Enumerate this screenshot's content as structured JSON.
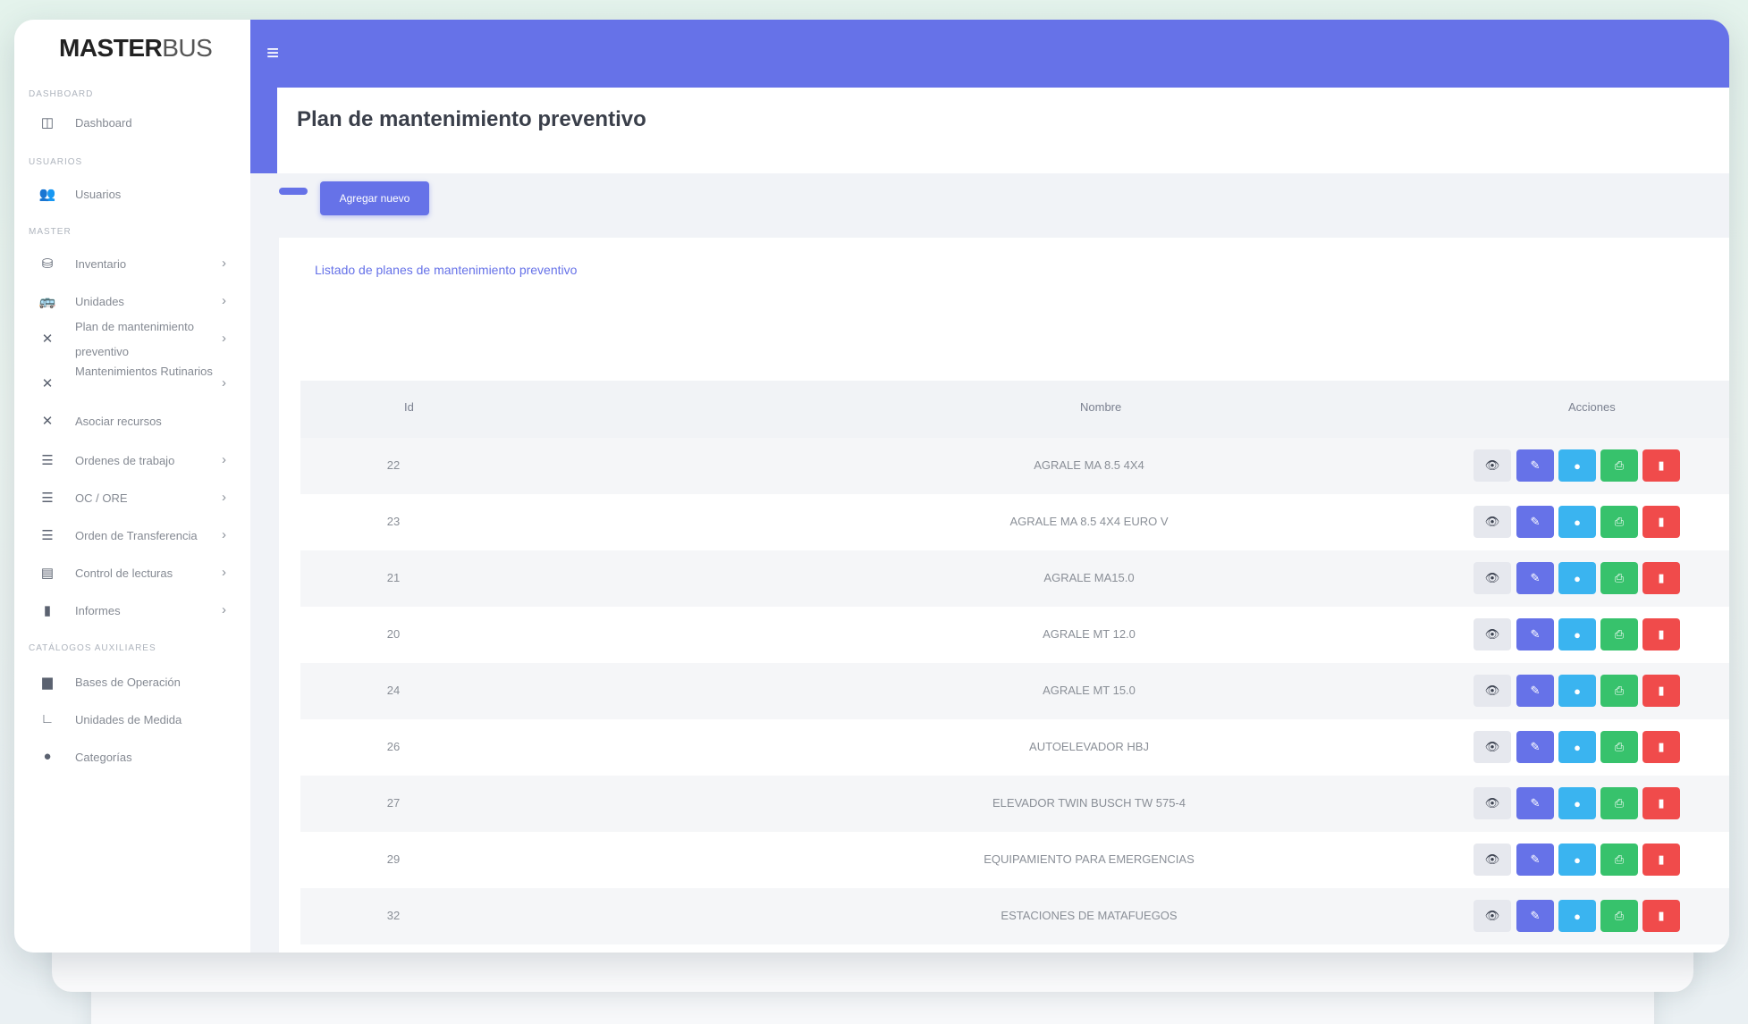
{
  "sidebar": {
    "logo_bold": "MASTER",
    "logo_light": "BUS",
    "sections": [
      {
        "title": "DASHBOARD"
      },
      {
        "title": "USUARIOS"
      },
      {
        "title": "MASTER"
      },
      {
        "title": "CATÁLOGOS AUXILIARES"
      }
    ],
    "items": [
      {
        "label": "Dashboard",
        "icon": "dashboard-icon",
        "glyph": "◫"
      },
      {
        "label": "Usuarios",
        "icon": "users-icon",
        "glyph": "👥"
      },
      {
        "label": "Inventario",
        "icon": "inventory-icon",
        "glyph": "⛁",
        "chevron": "›"
      },
      {
        "label": "Unidades",
        "icon": "bus-icon",
        "glyph": "🚌",
        "chevron": "›"
      },
      {
        "label": "Plan de mantenimiento preventivo",
        "icon": "tools-icon",
        "glyph": "✕",
        "chevron": "›"
      },
      {
        "label": "Mantenimientos Rutinarios",
        "icon": "tools-icon",
        "glyph": "✕",
        "chevron": "›"
      },
      {
        "label": "Asociar recursos",
        "icon": "tools-icon",
        "glyph": "✕"
      },
      {
        "label": "Ordenes de trabajo",
        "icon": "list-icon",
        "glyph": "☰",
        "chevron": "›"
      },
      {
        "label": "OC / ORE",
        "icon": "list-icon",
        "glyph": "☰",
        "chevron": "›"
      },
      {
        "label": "Orden de Transferencia",
        "icon": "list-icon",
        "glyph": "☰",
        "chevron": "›"
      },
      {
        "label": "Control de lecturas",
        "icon": "clipboard-icon",
        "glyph": "▤",
        "chevron": "›"
      },
      {
        "label": "Informes",
        "icon": "document-icon",
        "glyph": "▮",
        "chevron": "›"
      },
      {
        "label": "Bases de Operación",
        "icon": "building-icon",
        "glyph": "▆"
      },
      {
        "label": "Unidades de Medida",
        "icon": "ruler-icon",
        "glyph": "∟"
      },
      {
        "label": "Categorías",
        "icon": "tag-icon",
        "glyph": "●"
      }
    ]
  },
  "header": {
    "menu_icon": "≡",
    "page_title": "Plan de mantenimiento preventivo"
  },
  "toolbar": {
    "add_label": "Agregar nuevo"
  },
  "list": {
    "heading": "Listado de planes de mantenimiento preventivo",
    "columns": {
      "id": "Id",
      "name": "Nombre",
      "actions": "Acciones"
    },
    "rows": [
      {
        "id": "22",
        "name": "AGRALE MA 8.5 4X4"
      },
      {
        "id": "23",
        "name": "AGRALE MA 8.5 4X4 EURO V"
      },
      {
        "id": "21",
        "name": "AGRALE MA15.0"
      },
      {
        "id": "20",
        "name": "AGRALE MT 12.0"
      },
      {
        "id": "24",
        "name": "AGRALE MT 15.0"
      },
      {
        "id": "26",
        "name": "AUTOELEVADOR HBJ"
      },
      {
        "id": "27",
        "name": "ELEVADOR TWIN BUSCH TW 575-4"
      },
      {
        "id": "29",
        "name": "EQUIPAMIENTO PARA EMERGENCIAS"
      },
      {
        "id": "32",
        "name": "ESTACIONES DE MATAFUEGOS"
      }
    ],
    "action_icons": {
      "view": "👁",
      "edit": "✎",
      "chat": "●",
      "print": "⎙",
      "delete": "▮"
    }
  },
  "colors": {
    "primary": "#6672e8",
    "info": "#3ab4f0",
    "success": "#37c26c",
    "danger": "#f04b4b"
  }
}
